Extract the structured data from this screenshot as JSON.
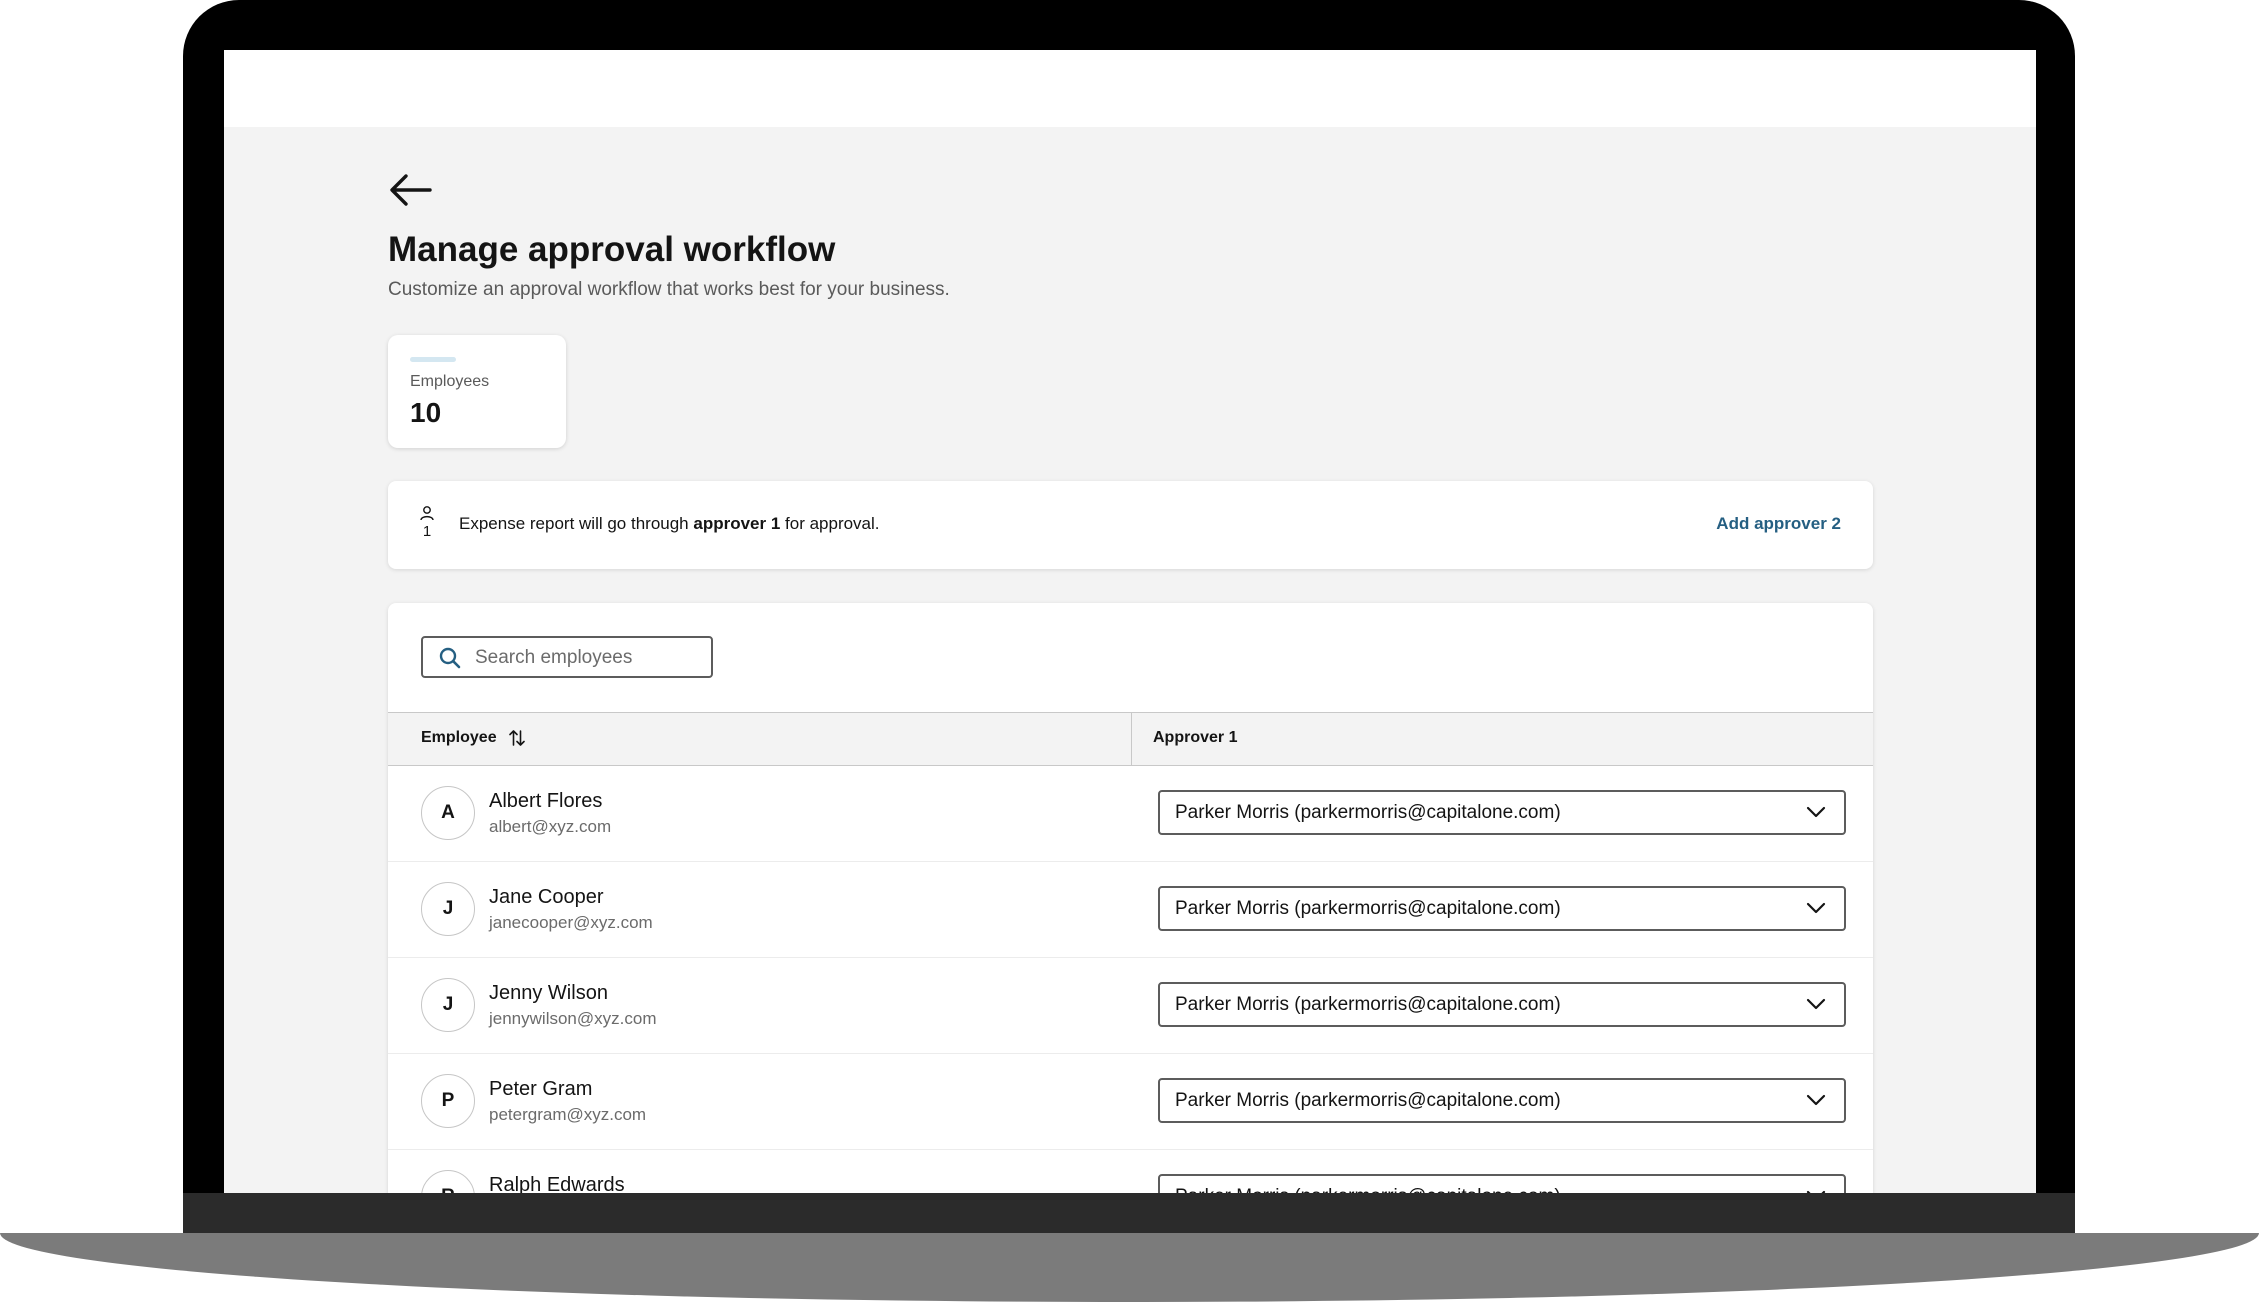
{
  "page": {
    "title": "Manage approval workflow",
    "subtitle": "Customize an approval workflow that works best for your business."
  },
  "back_button": {
    "icon": "arrow-left-icon"
  },
  "stat_card": {
    "label": "Employees",
    "value": "10",
    "accent_color": "#d4e7f1"
  },
  "info_banner": {
    "icon": "person-icon",
    "step_number": "1",
    "text_before": "Expense report will go through ",
    "text_bold": "approver 1",
    "text_after": " for approval.",
    "action_label": "Add approver 2",
    "action_color": "#255f82"
  },
  "search": {
    "placeholder": "Search employees",
    "value": "",
    "icon": "search-icon"
  },
  "table": {
    "columns": [
      {
        "label": "Employee",
        "sortable": true,
        "sort_icon": "sort-icon"
      },
      {
        "label": "Approver 1"
      }
    ],
    "rows": [
      {
        "initial": "A",
        "name": "Albert Flores",
        "email": "albert@xyz.com",
        "approver": "Parker Morris (parkermorris@capitalone.com)"
      },
      {
        "initial": "J",
        "name": "Jane Cooper",
        "email": "janecooper@xyz.com",
        "approver": "Parker Morris (parkermorris@capitalone.com)"
      },
      {
        "initial": "J",
        "name": "Jenny Wilson",
        "email": "jennywilson@xyz.com",
        "approver": "Parker Morris (parkermorris@capitalone.com)"
      },
      {
        "initial": "P",
        "name": "Peter Gram",
        "email": "petergram@xyz.com",
        "approver": "Parker Morris (parkermorris@capitalone.com)"
      },
      {
        "initial": "R",
        "name": "Ralph Edwards",
        "email": "",
        "approver": "Parker Morris (parkermorris@capitalone.com)"
      }
    ]
  }
}
